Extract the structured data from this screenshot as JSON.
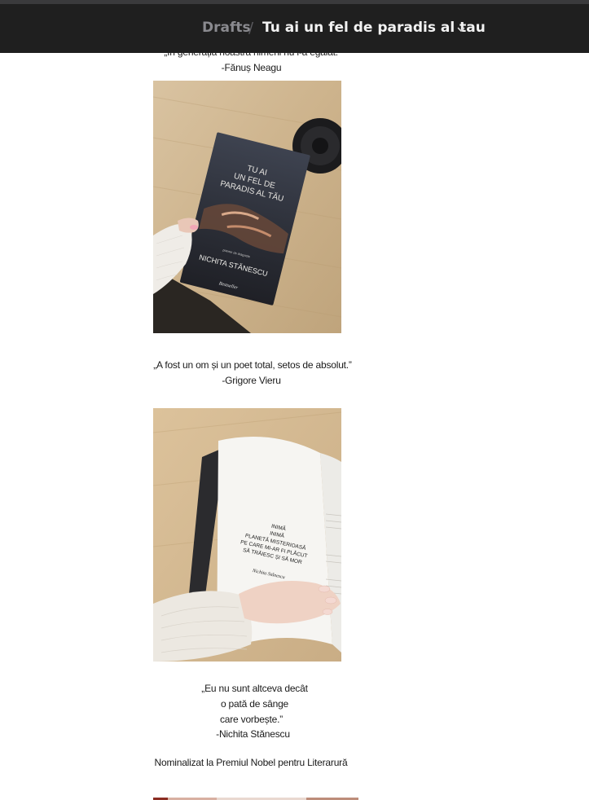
{
  "nav": {
    "parent_label": "Drafts",
    "separator": "/",
    "current_title": "Tu ai un fel de paradis al tau",
    "chevron_icon": "chevron-down-icon"
  },
  "content": {
    "quote1_line1": "„În generația noastră nimeni nu l-a egalat.”",
    "quote1_author": "-Fănuș Neagu",
    "quote2_line1": "„A fost un om și un poet total, setos de absolut.”",
    "quote2_author": "-Grigore Vieru",
    "quote3_line1": "„Eu nu sunt altceva decât",
    "quote3_line2": "o pată de sânge",
    "quote3_line3": "care vorbește.”",
    "quote3_author": "-Nichita Stănescu",
    "nomination": "Nominalizat la Premiul Nobel pentru Literarură"
  },
  "book_cover": {
    "title_line1": "TU AI",
    "title_line2": "UN FEL DE",
    "title_line3": "PARADIS AL TĂU",
    "subtitle": "poeme de dragoste",
    "author": "NICHITA STĂNESCU",
    "publisher": "Bestseller"
  },
  "book_page": {
    "poem_line1": "INIMĂ",
    "poem_line2": "INIMĂ",
    "poem_line3": "PLANETĂ MISTERIOASĂ",
    "poem_line4": "PE CARE MI-AR FI PLĂCUT",
    "poem_line5": "SĂ TRĂIESC ȘI SĂ MOR",
    "signature": "Nichita Stănescu"
  },
  "colors": {
    "nav_bg": "#1f1f1f",
    "nav_title": "#f2f2f2",
    "nav_muted": "#8a8a8f"
  }
}
